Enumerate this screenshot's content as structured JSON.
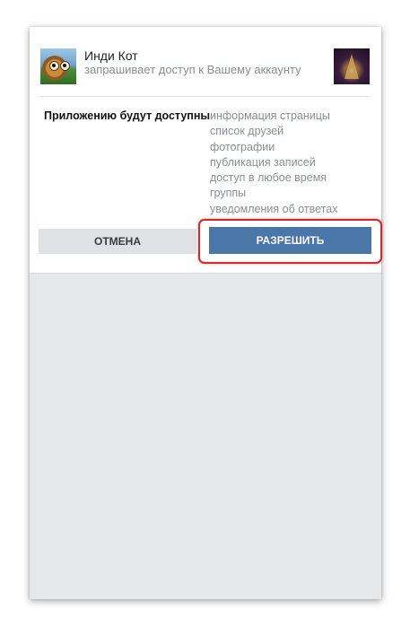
{
  "app": {
    "name": "Инди Кот",
    "request_text": "запрашивает доступ к Вашему аккаунту"
  },
  "permissions": {
    "title": "Приложению будут доступны",
    "items": [
      "информация страницы",
      "список друзей",
      "фотографии",
      "публикация записей",
      "доступ в любое время",
      "группы",
      "уведомления об ответах"
    ]
  },
  "buttons": {
    "cancel_label": "ОТМЕНА",
    "allow_label": "РАЗРЕШИТЬ"
  },
  "colors": {
    "allow_button": "#4a76a8",
    "cancel_button": "#dfe1e4",
    "highlight_border": "#d9262f",
    "screen_background": "#e6e7e9"
  }
}
